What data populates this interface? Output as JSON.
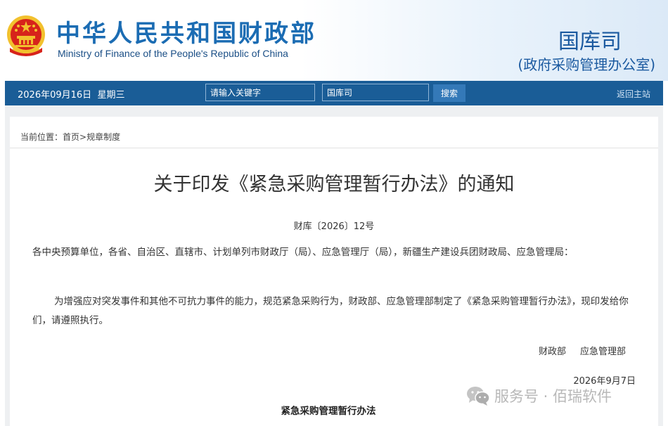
{
  "header": {
    "site_name_cn": "中华人民共和国财政部",
    "site_name_en": "Ministry of Finance of the People's Republic of China",
    "department": "国库司",
    "department_sub": "(政府采购管理办公室)",
    "emblem_icon": "national-emblem-icon"
  },
  "navbar": {
    "date": "2026年09月16日",
    "weekday": "星期三",
    "search_placeholder": "请输入关键字",
    "scope_value": "国库司",
    "search_button": "搜索",
    "home_link": "返回主站"
  },
  "breadcrumb": {
    "prefix": "当前位置：",
    "home": "首页",
    "separator": ">",
    "current": "规章制度"
  },
  "article": {
    "title": "关于印发《紧急采购管理暂行办法》的通知",
    "doc_number": "财库〔2026〕12号",
    "recipients": "各中央预算单位，各省、自治区、直辖市、计划单列市财政厅（局）、应急管理厅（局），新疆生产建设兵团财政局、应急管理局：",
    "body": "为增强应对突发事件和其他不可抗力事件的能力，规范紧急采购行为，财政部、应急管理部制定了《紧急采购管理暂行办法》，现印发给你们，请遵照执行。",
    "signer_1": "财政部",
    "signer_2": "应急管理部",
    "sign_date": "2026年9月7日",
    "attachment_title": "紧急采购管理暂行办法"
  },
  "watermark": {
    "text": "服务号 · 佰瑞软件",
    "icon": "wechat-icon"
  },
  "colors": {
    "brand_blue": "#1b6cb3",
    "navbar_bg": "#1a5d97",
    "button_bg": "#3479b8",
    "emblem_red": "#d7231b",
    "emblem_gold": "#f2c12e"
  }
}
